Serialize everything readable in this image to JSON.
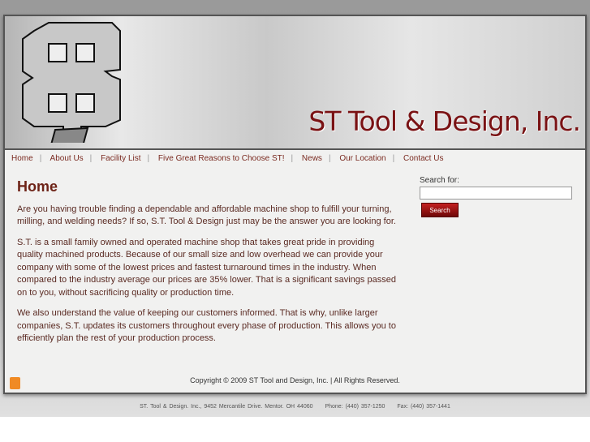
{
  "header": {
    "brand": "ST Tool & Design, Inc."
  },
  "nav": [
    "Home",
    "About Us",
    "Facility List",
    "Five Great Reasons to Choose ST!",
    "News",
    "Our Location",
    "Contact Us"
  ],
  "main": {
    "title": "Home",
    "paragraphs": [
      "Are you having trouble finding a dependable and affordable machine shop to fulfill your turning, milling, and welding needs? If so, S.T. Tool & Design just may be the answer you are looking for.",
      "S.T. is a small family owned and operated machine shop that takes great pride in providing quality machined products. Because of our small size and low overhead we can provide your company with some of the lowest prices and fastest turnaround times in the industry. When compared to the industry average our prices are 35% lower. That is a significant savings passed on to you, without sacrificing quality or production time.",
      "We also understand the value of keeping our customers informed. That is why, unlike larger companies, S.T. updates its customers throughout every phase of production. This allows you to efficiently plan the rest of your production process."
    ]
  },
  "search": {
    "label": "Search for:",
    "value": "",
    "button": "Search"
  },
  "footer": {
    "copyright": "Copyright © 2009 ST Tool and Design, Inc. | All Rights Reserved.",
    "address": "ST. Tool & Design. Inc., 9452 Mercantile Drive. Mentor. OH 44060",
    "phone": "Phone: (440) 357-1250",
    "fax": "Fax: (440) 357-1441"
  }
}
